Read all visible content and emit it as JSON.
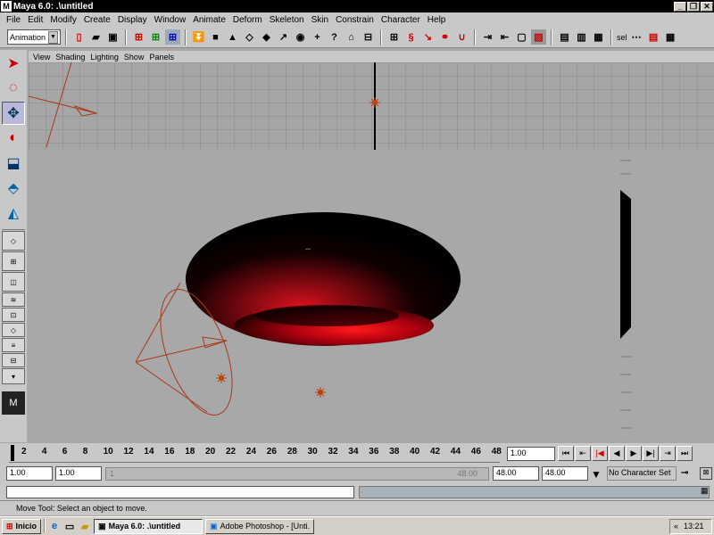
{
  "window": {
    "title": "Maya 6.0: .\\untitled",
    "min_label": "_",
    "restore_label": "❐",
    "close_label": "✕"
  },
  "menubar": [
    "File",
    "Edit",
    "Modify",
    "Create",
    "Display",
    "Window",
    "Animate",
    "Deform",
    "Skeleton",
    "Skin",
    "Constrain",
    "Character",
    "Help"
  ],
  "shelf": {
    "mode": "Animation",
    "sel_label": "sel"
  },
  "panel_menu": [
    "View",
    "Shading",
    "Lighting",
    "Show",
    "Panels"
  ],
  "time_ticks": [
    "2",
    "4",
    "6",
    "8",
    "10",
    "12",
    "14",
    "16",
    "18",
    "20",
    "22",
    "24",
    "26",
    "28",
    "30",
    "32",
    "34",
    "36",
    "38",
    "40",
    "42",
    "44",
    "46",
    "48"
  ],
  "current_time": "1.00",
  "range": {
    "start": "1.00",
    "inner_start": "1.00",
    "slider_start": "1",
    "slider_end": "48.00",
    "end": "48.00",
    "outer_end": "48.00",
    "char_set": "No Character Set"
  },
  "helpline": "Move Tool: Select an object to move.",
  "taskbar": {
    "start": "Inicio",
    "task1": "Maya 6.0: .\\untitled",
    "task2": "Adobe Photoshop - [Unti...",
    "tray_arrow": "«",
    "clock": "13:21"
  },
  "colors": {
    "viewport_bg": "#a8a8a8",
    "torus_red": "#e0121c",
    "light_lines": "#a83a1c"
  }
}
